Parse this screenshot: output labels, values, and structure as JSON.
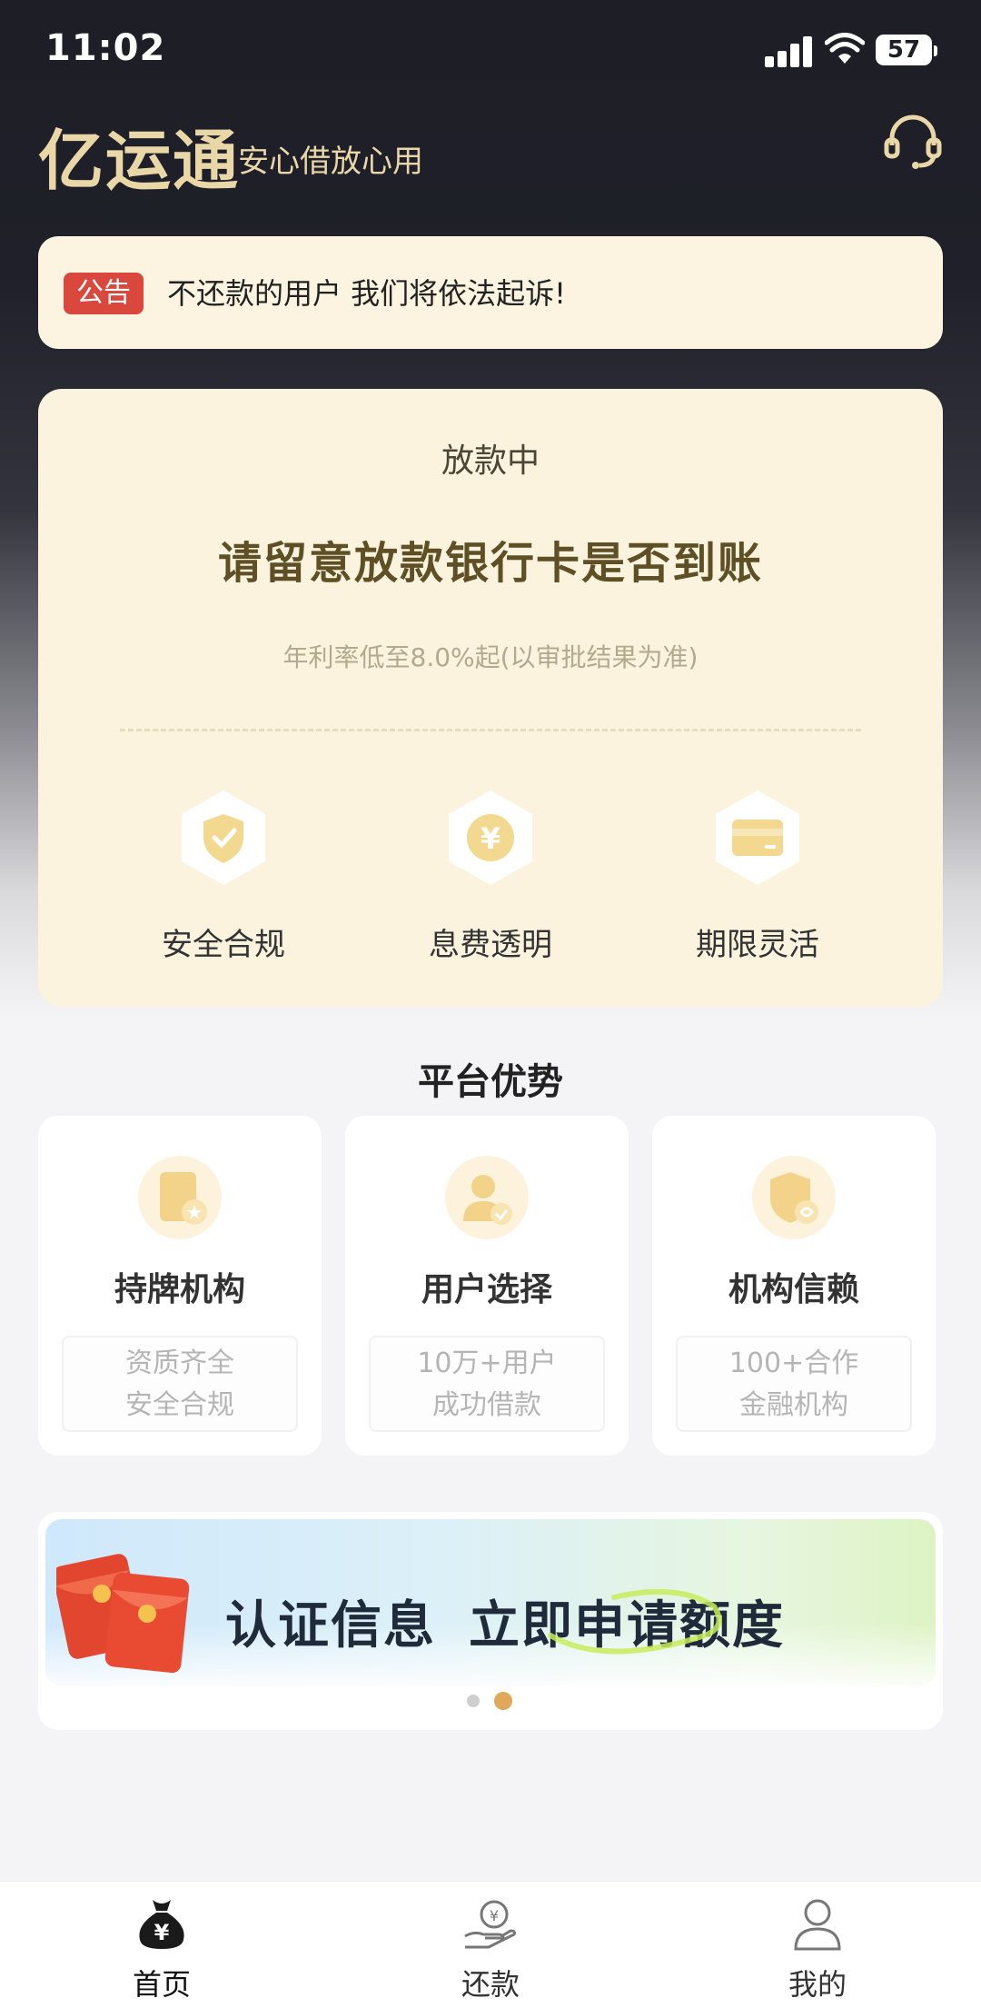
{
  "status_bar": {
    "time": "11:02",
    "battery": "57"
  },
  "header": {
    "brand": "亿运通",
    "slogan": "安心借放心用"
  },
  "notice": {
    "tag": "公告",
    "text": "不还款的用户 我们将依法起诉!"
  },
  "loan_status": {
    "label": "放款中",
    "title": "请留意放款银行卡是否到账",
    "subtitle": "年利率低至8.0%起(以审批结果为准)",
    "features": [
      {
        "label": "安全合规",
        "icon": "shield-check-icon"
      },
      {
        "label": "息费透明",
        "icon": "yuan-coin-icon"
      },
      {
        "label": "期限灵活",
        "icon": "card-icon"
      }
    ]
  },
  "advantages": {
    "title": "平台优势",
    "cards": [
      {
        "name": "持牌机构",
        "line1": "资质齐全",
        "line2": "安全合规",
        "icon": "license-icon"
      },
      {
        "name": "用户选择",
        "line1": "10万+用户",
        "line2": "成功借款",
        "icon": "user-check-icon"
      },
      {
        "name": "机构信赖",
        "line1": "100+合作",
        "line2": "金融机构",
        "icon": "trust-shield-icon"
      }
    ]
  },
  "banner": {
    "text_left": "认证信息",
    "text_right": "立即申请额度",
    "icon": "red-envelope-icon",
    "page_count": 2,
    "active_page": 2
  },
  "tabbar": {
    "items": [
      {
        "label": "首页",
        "icon": "money-bag-icon",
        "active": true
      },
      {
        "label": "还款",
        "icon": "repay-hand-icon",
        "active": false
      },
      {
        "label": "我的",
        "icon": "user-icon",
        "active": false
      }
    ]
  },
  "colors": {
    "gold": "#e9d7a8",
    "card": "#fbf3de",
    "tag_red": "#d9473d",
    "title_brown": "#5e4f25",
    "dot_active": "#e0a85a"
  }
}
